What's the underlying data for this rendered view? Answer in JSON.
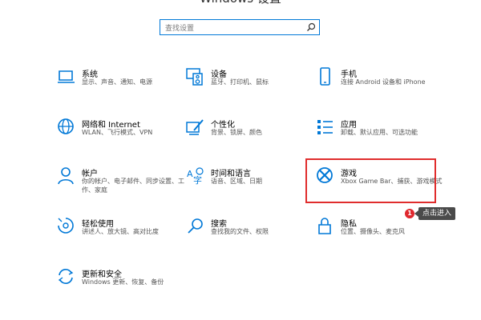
{
  "window": {
    "title": "Windows 设置"
  },
  "search": {
    "placeholder": "查找设置"
  },
  "tiles": [
    {
      "name": "系统",
      "desc": "显示、声音、通知、电源",
      "icon": "laptop-icon"
    },
    {
      "name": "设备",
      "desc": "蓝牙、打印机、鼠标",
      "icon": "devices-icon"
    },
    {
      "name": "手机",
      "desc": "连接 Android 设备和 iPhone",
      "icon": "phone-icon"
    },
    {
      "name": "网络和 Internet",
      "desc": "WLAN、飞行模式、VPN",
      "icon": "globe-icon"
    },
    {
      "name": "个性化",
      "desc": "背景、锁屏、颜色",
      "icon": "personalization-icon"
    },
    {
      "name": "应用",
      "desc": "卸载、默认应用、可选功能",
      "icon": "apps-list-icon"
    },
    {
      "name": "帐户",
      "desc": "你的帐户、电子邮件、同步设置、工作、家庭",
      "icon": "person-icon"
    },
    {
      "name": "时间和语言",
      "desc": "语音、区域、日期",
      "icon": "time-language-icon"
    },
    {
      "name": "游戏",
      "desc": "Xbox Game Bar、捕获、游戏模式",
      "icon": "xbox-icon"
    },
    {
      "name": "轻松使用",
      "desc": "讲述人、放大镜、高对比度",
      "icon": "ease-of-access-icon"
    },
    {
      "name": "搜索",
      "desc": "查找我的文件、权限",
      "icon": "search-icon"
    },
    {
      "name": "隐私",
      "desc": "位置、摄像头、麦克风",
      "icon": "lock-icon"
    },
    {
      "name": "更新和安全",
      "desc": "Windows 更新、恢复、备份",
      "icon": "update-icon"
    }
  ],
  "annotation": {
    "badge": "1",
    "tooltip": "点击进入"
  },
  "colors": {
    "accent": "#0078d7",
    "highlight": "#e02d2d"
  }
}
